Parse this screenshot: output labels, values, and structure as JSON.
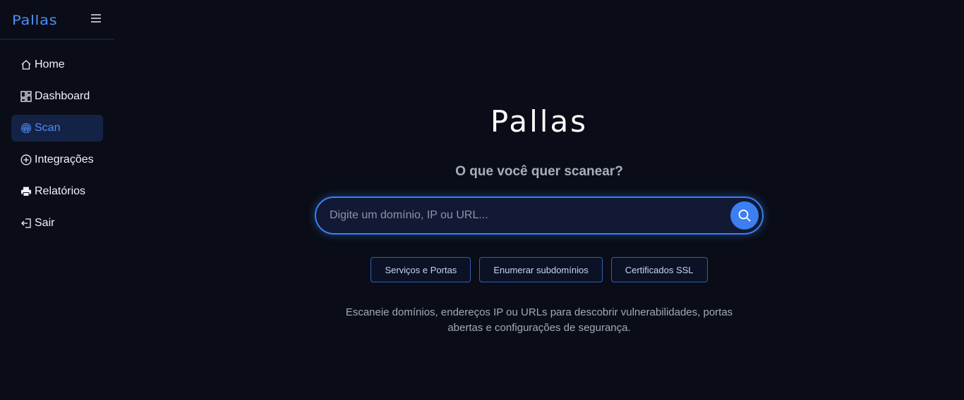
{
  "sidebar": {
    "brand": "Pallas",
    "menu_icon": "hamburger-icon",
    "items": [
      {
        "label": "Home",
        "icon": "home-icon"
      },
      {
        "label": "Dashboard",
        "icon": "dashboard-icon"
      },
      {
        "label": "Scan",
        "icon": "fingerprint-icon",
        "active": true
      },
      {
        "label": "Integrações",
        "icon": "plus-circle-icon"
      },
      {
        "label": "Relatórios",
        "icon": "printer-icon"
      },
      {
        "label": "Sair",
        "icon": "logout-icon"
      }
    ]
  },
  "main": {
    "title": "Pallas",
    "subtitle": "O que você quer scanear?",
    "search": {
      "value": "",
      "placeholder": "Digite um domínio, IP ou URL...",
      "button_icon": "search-icon"
    },
    "chips": [
      "Serviços e Portas",
      "Enumerar subdomínios",
      "Certificados SSL"
    ],
    "description": "Escaneie domínios, endereços IP ou URLs para descobrir vulnerabilidades, portas abertas e configurações de segurança."
  },
  "colors": {
    "background": "#0a0d17",
    "accent": "#3b7ff0",
    "active_bg": "#142246"
  }
}
